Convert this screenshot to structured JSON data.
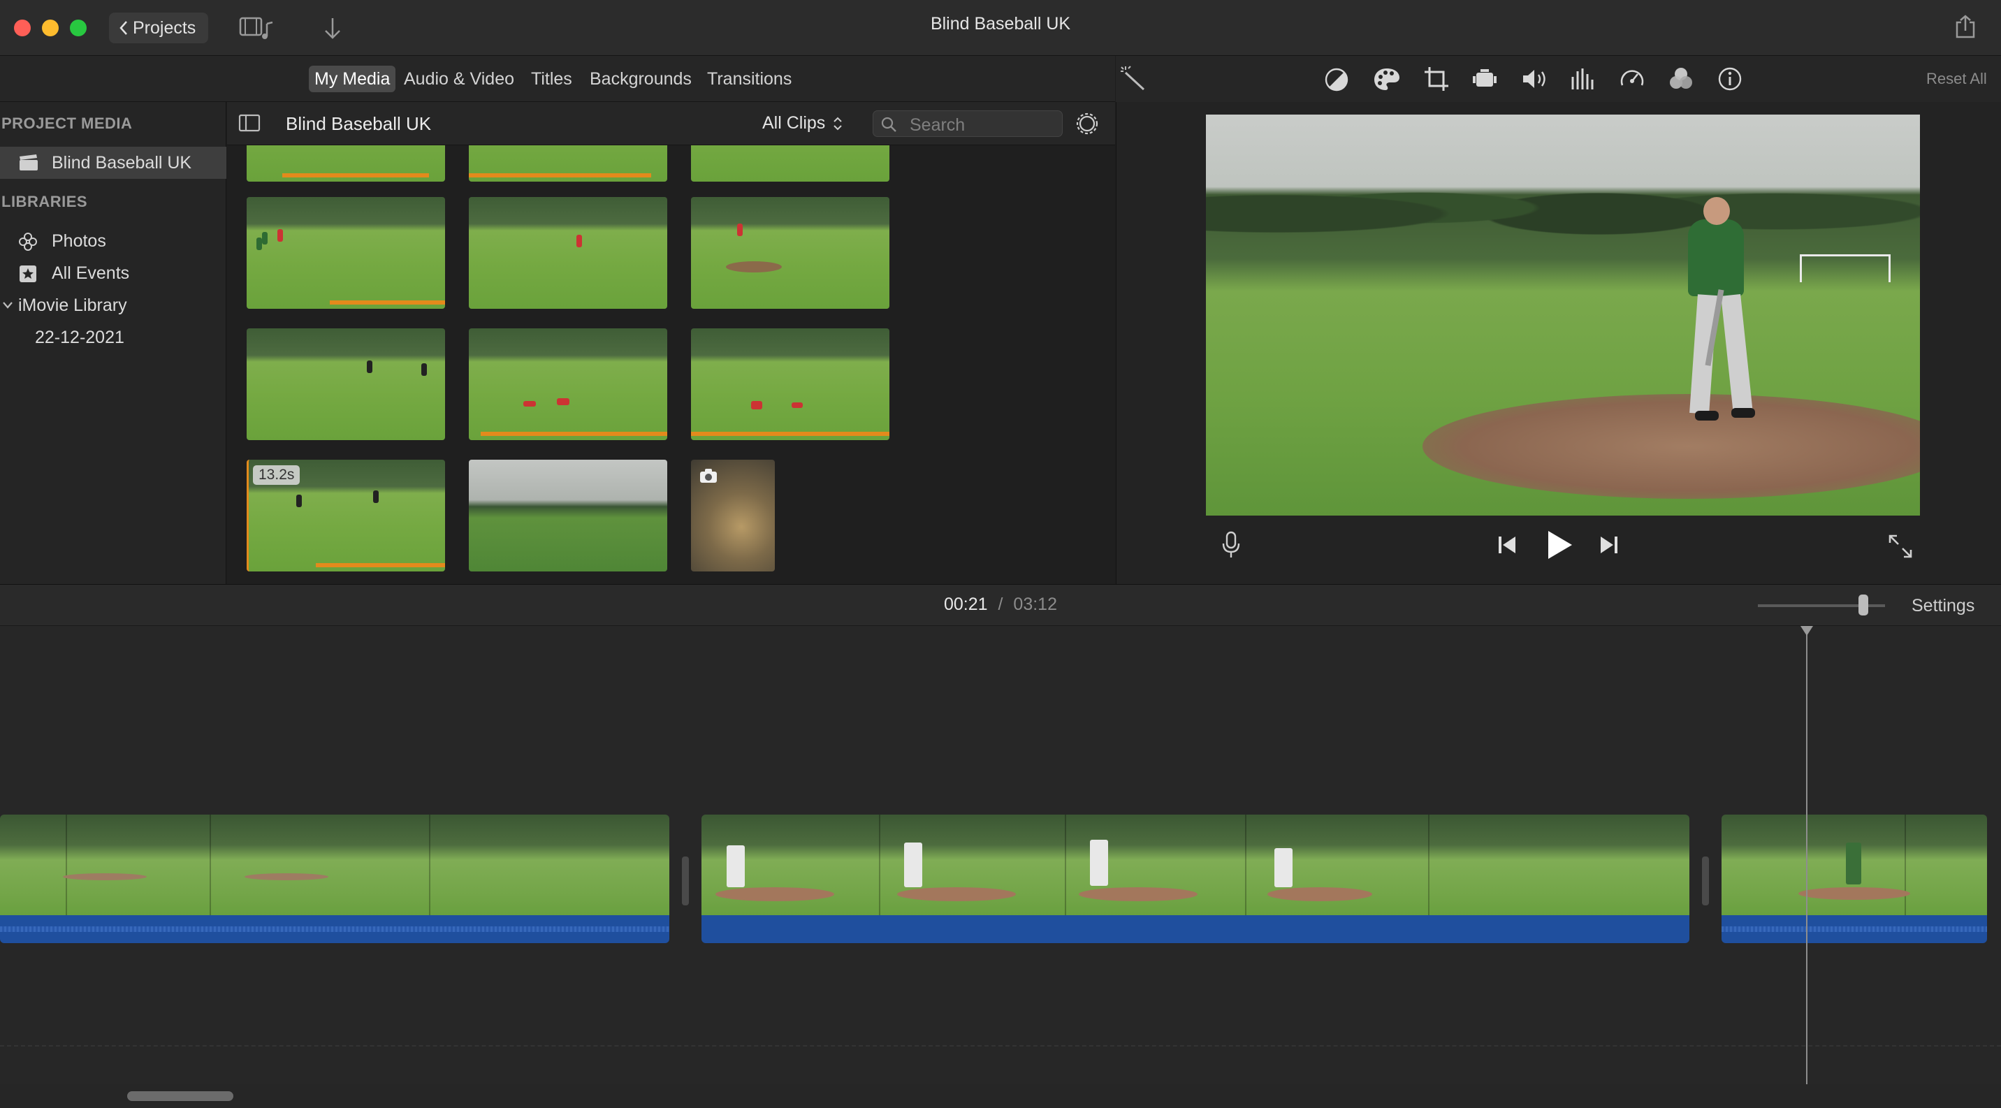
{
  "window": {
    "title": "Blind Baseball UK",
    "back_button": "Projects"
  },
  "browser_tabs": [
    "My Media",
    "Audio & Video",
    "Titles",
    "Backgrounds",
    "Transitions"
  ],
  "viewer": {
    "reset_all": "Reset All"
  },
  "sidebar": {
    "project_media_header": "PROJECT MEDIA",
    "project_item": "Blind Baseball UK",
    "libraries_header": "LIBRARIES",
    "items": [
      "Photos",
      "All Events",
      "iMovie Library",
      "22-12-2021"
    ]
  },
  "browser": {
    "title": "Blind Baseball UK",
    "filter": "All Clips",
    "search_placeholder": "Search",
    "clip_duration_badge": "13.2s"
  },
  "timeline": {
    "current_time": "00:21",
    "separator": "/",
    "total_time": "03:12",
    "settings_label": "Settings"
  },
  "colors": {
    "close": "#ff5f57",
    "minimize": "#febc2e",
    "zoom": "#28c840",
    "clip_used_bar": "#e38a1c",
    "audio_track": "#1f4f9e"
  }
}
